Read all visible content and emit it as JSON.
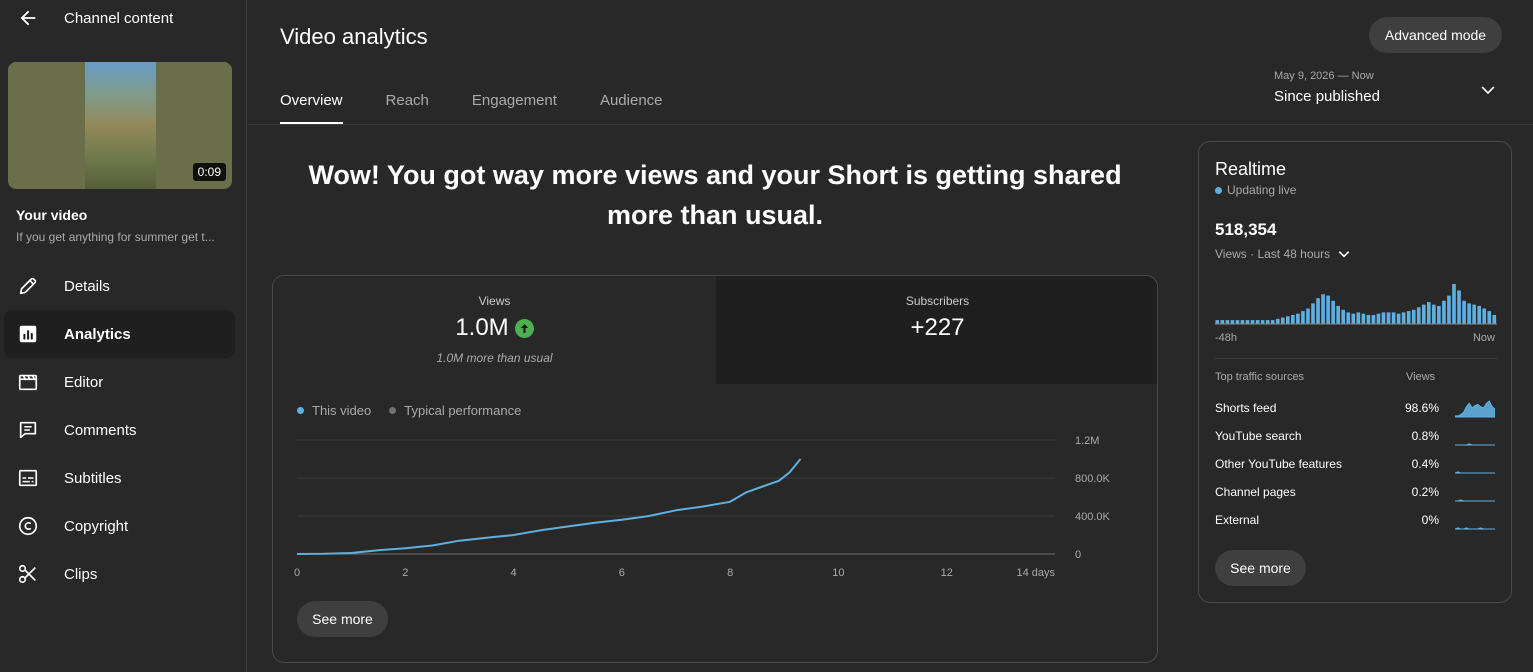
{
  "sidebar": {
    "title": "Channel content",
    "thumbnail_duration": "0:09",
    "your_video_label": "Your video",
    "video_description": "If you get anything for summer get t...",
    "items": [
      {
        "label": "Details",
        "icon": "pencil-icon",
        "active": false
      },
      {
        "label": "Analytics",
        "icon": "analytics-icon",
        "active": true
      },
      {
        "label": "Editor",
        "icon": "clapperboard-icon",
        "active": false
      },
      {
        "label": "Comments",
        "icon": "comment-icon",
        "active": false
      },
      {
        "label": "Subtitles",
        "icon": "subtitles-icon",
        "active": false
      },
      {
        "label": "Copyright",
        "icon": "copyright-icon",
        "active": false
      },
      {
        "label": "Clips",
        "icon": "scissors-icon",
        "active": false
      }
    ]
  },
  "header": {
    "title": "Video analytics",
    "advanced_mode_label": "Advanced mode",
    "tabs": [
      {
        "label": "Overview",
        "active": true
      },
      {
        "label": "Reach",
        "active": false
      },
      {
        "label": "Engagement",
        "active": false
      },
      {
        "label": "Audience",
        "active": false
      }
    ],
    "date_range_sub": "May 9, 2026 — Now",
    "date_range_main": "Since published"
  },
  "headline": "Wow! You got way more views and your Short is getting shared more than usual.",
  "metrics": {
    "views": {
      "label": "Views",
      "value": "1.0M",
      "note": "1.0M more than usual"
    },
    "subscribers": {
      "label": "Subscribers",
      "value": "+227"
    }
  },
  "legend": {
    "this_video": "This video",
    "typical": "Typical performance"
  },
  "see_more_label": "See more",
  "colors": {
    "accent": "#5fb0e0",
    "up": "#4caf50",
    "typical": "#717171"
  },
  "chart_data": {
    "type": "line",
    "x_tick_labels": [
      "0",
      "2",
      "4",
      "6",
      "8",
      "10",
      "12",
      "14 days"
    ],
    "y_tick_labels": [
      "1.2M",
      "800.0K",
      "400.0K",
      "0"
    ],
    "xlim": [
      0,
      14
    ],
    "ylim": [
      0,
      1200000
    ],
    "series": [
      {
        "name": "This video",
        "x": [
          0,
          0.5,
          1.0,
          1.5,
          2.0,
          2.5,
          3.0,
          3.5,
          4.0,
          4.5,
          5.0,
          5.5,
          6.0,
          6.5,
          7.0,
          7.5,
          8.0,
          8.3,
          8.6,
          8.9,
          9.1,
          9.3
        ],
        "y": [
          0,
          2000,
          10000,
          40000,
          60000,
          90000,
          140000,
          170000,
          200000,
          250000,
          290000,
          330000,
          360000,
          400000,
          460000,
          500000,
          550000,
          650000,
          710000,
          770000,
          860000,
          1000000
        ]
      }
    ]
  },
  "realtime": {
    "title": "Realtime",
    "live_label": "Updating live",
    "views_total": "518,354",
    "period_label": "Views · Last 48 hours",
    "axis_left": "-48h",
    "axis_right": "Now",
    "bars": [
      3,
      3,
      3,
      3,
      3,
      3,
      3,
      3,
      3,
      3,
      3,
      3,
      4,
      5,
      6,
      7,
      8,
      10,
      12,
      16,
      20,
      23,
      22,
      18,
      14,
      11,
      9,
      8,
      9,
      8,
      7,
      7,
      8,
      9,
      9,
      9,
      8,
      9,
      10,
      11,
      13,
      15,
      17,
      15,
      14,
      18,
      22,
      31,
      26,
      18,
      16,
      15,
      14,
      12,
      10,
      7
    ],
    "traffic_header": "Top traffic sources",
    "traffic_views_header": "Views",
    "traffic_sources": [
      {
        "name": "Shorts feed",
        "pct": "98.6%",
        "spark": [
          1,
          1,
          2,
          4,
          9,
          12,
          8,
          10,
          11,
          9,
          8,
          12,
          14,
          9,
          7
        ]
      },
      {
        "name": "YouTube search",
        "pct": "0.8%",
        "spark": [
          0,
          0,
          0,
          0,
          0,
          1,
          0,
          0,
          0,
          0,
          0,
          0,
          0,
          0,
          0
        ]
      },
      {
        "name": "Other YouTube features",
        "pct": "0.4%",
        "spark": [
          0,
          1,
          0,
          0,
          0,
          0,
          0,
          0,
          0,
          0,
          0,
          0,
          0,
          0,
          0
        ]
      },
      {
        "name": "Channel pages",
        "pct": "0.2%",
        "spark": [
          0,
          0,
          1,
          0,
          0,
          0,
          0,
          0,
          0,
          0,
          0,
          0,
          0,
          0,
          0
        ]
      },
      {
        "name": "External",
        "pct": "0%",
        "spark": [
          0,
          1,
          0,
          0,
          1,
          0,
          0,
          0,
          0,
          1,
          0,
          0,
          0,
          0,
          0
        ]
      }
    ]
  }
}
